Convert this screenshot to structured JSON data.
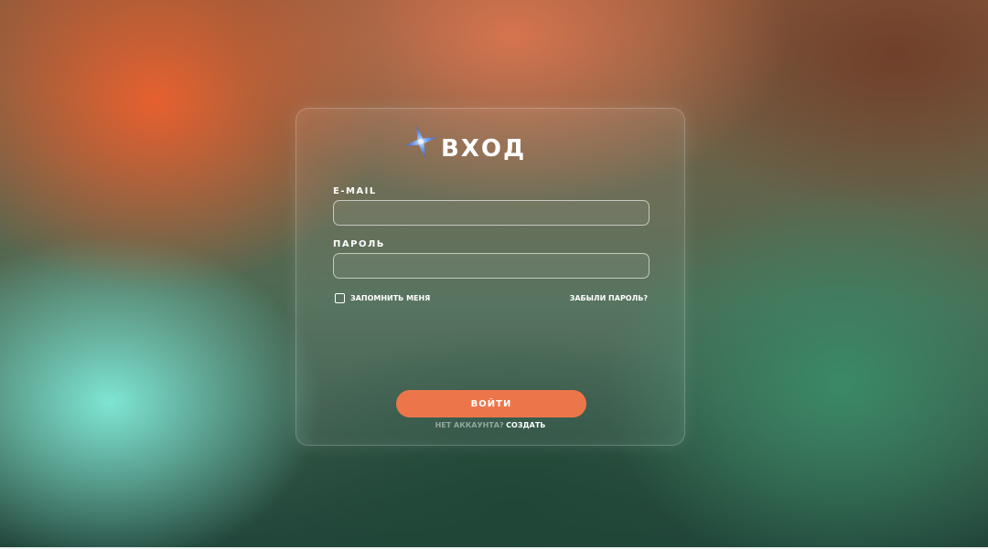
{
  "login": {
    "title": "ВХОД",
    "email_label": "E-MAIL",
    "email_value": "",
    "password_label": "ПАРОЛЬ",
    "password_value": "",
    "remember_label": "ЗАПОМНИТЬ МЕНЯ",
    "forgot_label": "ЗАБЫЛИ ПАРОЛЬ?",
    "submit_label": "ВОЙТИ",
    "signup_prompt": "НЕТ АККАУНТА?",
    "signup_link": "СОЗДАТЬ"
  },
  "icons": {
    "logo": "four-point-star-icon",
    "checkbox": "checkbox-unchecked-icon"
  },
  "colors": {
    "accent": "#ec764a",
    "text": "#ffffff"
  }
}
